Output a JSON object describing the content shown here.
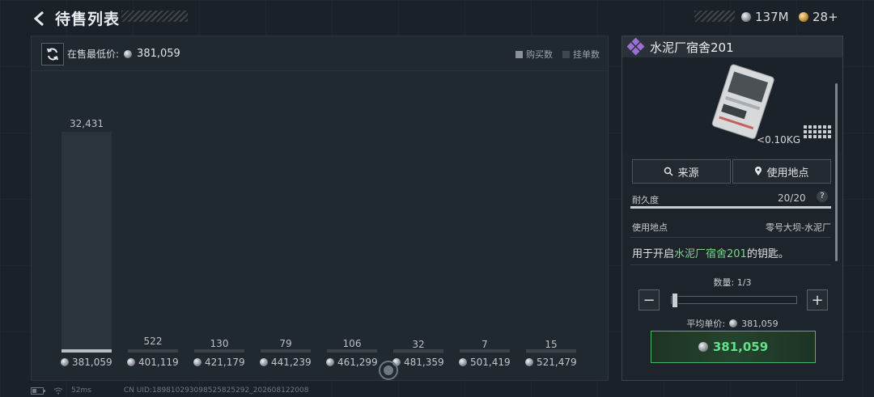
{
  "header": {
    "title": "待售列表",
    "currency_silver": "137M",
    "currency_gold": "28+"
  },
  "market": {
    "min_price_label": "在售最低价:",
    "min_price_value": "381,059",
    "legend_buy": "购买数",
    "legend_list": "挂单数"
  },
  "chart_data": {
    "type": "bar",
    "categories": [
      "381,059",
      "401,119",
      "421,179",
      "441,239",
      "461,299",
      "481,359",
      "501,419",
      "521,479"
    ],
    "values": [
      32431,
      522,
      130,
      79,
      106,
      32,
      7,
      15
    ],
    "value_labels": [
      "32,431",
      "522",
      "130",
      "79",
      "106",
      "32",
      "7",
      "15"
    ],
    "xlabel": "",
    "ylabel": ""
  },
  "item": {
    "name": "水泥厂宿舍201",
    "weight": "<0.10KG",
    "source_button": "来源",
    "usage_button": "使用地点",
    "durability_label": "耐久度",
    "durability_value": "20/20",
    "help_icon": "?",
    "location_label": "使用地点",
    "location_value": "零号大坝-水泥厂",
    "desc_prefix": "用于开启",
    "desc_highlight": "水泥厂宿舍201",
    "desc_suffix": "的钥匙。"
  },
  "purchase": {
    "quantity_label": "数量: 1/3",
    "quantity_fraction": 0.0,
    "avg_price_label": "平均单价:",
    "avg_price_value": "381,059",
    "buy_button_value": "381,059",
    "minus": "−",
    "plus": "+"
  },
  "footer": {
    "latency": "52ms",
    "uid": "CN UID:189810293098525825292_202608122008"
  },
  "colors": {
    "accent_green": "#63e08a",
    "highlight_green": "#7dd48f",
    "rarity_purple": "#9b6fd4"
  }
}
